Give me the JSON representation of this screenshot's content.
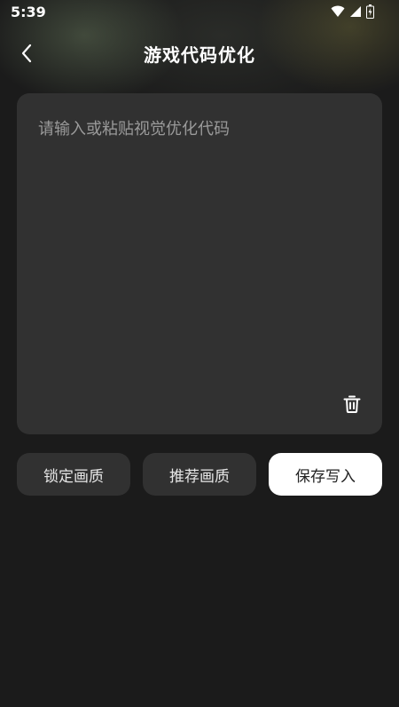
{
  "status_bar": {
    "time": "5:39"
  },
  "header": {
    "title": "游戏代码优化"
  },
  "code_box": {
    "placeholder": "请输入或粘贴视觉优化代码",
    "value": ""
  },
  "actions": {
    "lock_quality": "锁定画质",
    "recommend_quality": "推荐画质",
    "save_write": "保存写入"
  },
  "colors": {
    "background": "#1b1b1b",
    "card": "#313131",
    "primary_button": "#ffffff"
  }
}
